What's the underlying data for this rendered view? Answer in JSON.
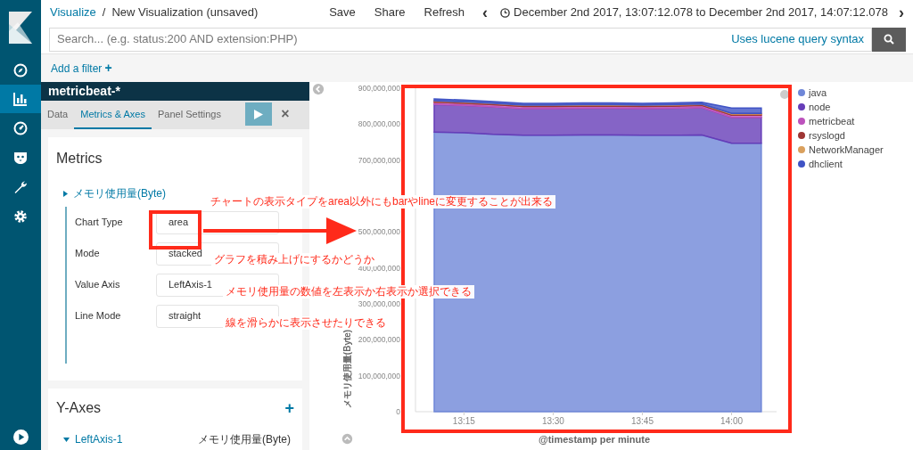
{
  "breadcrumb": {
    "link": "Visualize",
    "separator": "/",
    "current": "New Visualization (unsaved)"
  },
  "top_actions": [
    "Save",
    "Share",
    "Refresh"
  ],
  "time_range": {
    "prev": "‹",
    "text": "December 2nd 2017, 13:07:12.078 to December 2nd 2017, 14:07:12.078",
    "next": "›"
  },
  "search": {
    "placeholder": "Search... (e.g. status:200 AND extension:PHP)",
    "syntax_link": "Uses lucene query syntax"
  },
  "filter_bar": {
    "add_filter": "Add a filter",
    "plus": "+"
  },
  "nav": [
    {
      "kind": "discover",
      "selected": false
    },
    {
      "kind": "visualize",
      "selected": true
    },
    {
      "kind": "dashboard",
      "selected": false
    },
    {
      "kind": "timelion",
      "selected": false
    },
    {
      "kind": "devtools",
      "selected": false
    },
    {
      "kind": "settings",
      "selected": false
    }
  ],
  "index_pattern": "metricbeat-*",
  "editor_tabs": [
    {
      "label": "Data",
      "selected": false
    },
    {
      "label": "Metrics & Axes",
      "selected": true
    },
    {
      "label": "Panel Settings",
      "selected": false
    }
  ],
  "close": "×",
  "metrics": {
    "title": "Metrics",
    "series_label": "メモリ使用量(Byte)",
    "expanded": true,
    "fields": [
      {
        "label": "Chart Type",
        "value": "area"
      },
      {
        "label": "Mode",
        "value": "stacked"
      },
      {
        "label": "Value Axis",
        "value": "LeftAxis-1"
      },
      {
        "label": "Line Mode",
        "value": "straight"
      }
    ]
  },
  "y_axes": {
    "title": "Y-Axes",
    "add": "+",
    "axis": "LeftAxis-1",
    "axis_series": "メモリ使用量(Byte)",
    "expanded": true
  },
  "chart_data": {
    "type": "area",
    "stacked": true,
    "xlabel": "@timestamp per minute",
    "ylabel": "メモリ使用量(Byte)",
    "categories": [
      null,
      "13:15",
      null,
      null,
      "13:30",
      null,
      null,
      "13:45",
      null,
      null,
      "14:00",
      null
    ],
    "ylim": [
      0,
      900000000
    ],
    "yticks": [
      {
        "value": 0,
        "label": "0"
      },
      {
        "value": 100000000,
        "label": "100,000,000"
      },
      {
        "value": 200000000,
        "label": "200,000,000"
      },
      {
        "value": 300000000,
        "label": "300,000,000"
      },
      {
        "value": 400000000,
        "label": "400,000,000"
      },
      {
        "value": 500000000,
        "label": "500,000,000"
      },
      {
        "value": 700000000,
        "label": "700,000,000"
      },
      {
        "value": 800000000,
        "label": "800,000,000"
      },
      {
        "value": 900000000,
        "label": "900,000,000"
      }
    ],
    "series": [
      {
        "name": "java",
        "color": "#6f87d8",
        "values": [
          778000000,
          776000000,
          772000000,
          769000000,
          769000000,
          770000000,
          770000000,
          769000000,
          769000000,
          770000000,
          747000000,
          747000000
        ]
      },
      {
        "name": "node",
        "color": "#663db8",
        "values": [
          77000000,
          76000000,
          76000000,
          74000000,
          74000000,
          74000000,
          74000000,
          74000000,
          75000000,
          76000000,
          72000000,
          72000000
        ]
      },
      {
        "name": "metricbeat",
        "color": "#bc52bc",
        "values": [
          6000000,
          6000000,
          6000000,
          6000000,
          6000000,
          6000000,
          6000000,
          6000000,
          6000000,
          6000000,
          6000000,
          6000000
        ]
      },
      {
        "name": "rsyslogd",
        "color": "#9e3533",
        "values": [
          3000000,
          3000000,
          3000000,
          3000000,
          3000000,
          3000000,
          3000000,
          3000000,
          3000000,
          3000000,
          3000000,
          3000000
        ]
      },
      {
        "name": "NetworkManager",
        "color": "#daa05d",
        "values": [
          1000000,
          1000000,
          1000000,
          1000000,
          1000000,
          1000000,
          1000000,
          1000000,
          1000000,
          1000000,
          2000000,
          2000000
        ]
      },
      {
        "name": "dhclient",
        "color": "#3f53c5",
        "values": [
          5000000,
          5000000,
          5000000,
          5000000,
          5000000,
          5000000,
          5000000,
          5000000,
          5000000,
          5000000,
          15000000,
          15000000
        ]
      }
    ]
  },
  "annotations": [
    "チャートの表示タイプをarea以外にもbarやlineに変更することが出来る",
    "グラフを積み上げにするかどうか",
    "メモリ使用量の数値を左表示か右表示か選択できる",
    "線を滑らかに表示させたりできる"
  ]
}
